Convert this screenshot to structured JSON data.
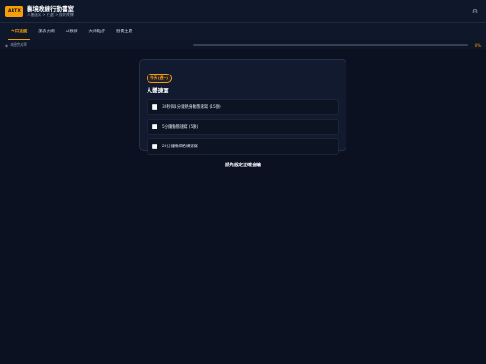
{
  "header": {
    "logo_text": "ARTX",
    "title": "藝境教練行動書室",
    "breadcrumb": "人體速寫 > 任選 > 我的教練",
    "settings_icon": "gear-icon"
  },
  "tabs": [
    {
      "label": "今日進度",
      "active": true
    },
    {
      "label": "課表大綱",
      "active": false
    },
    {
      "label": "AI教練",
      "active": false
    },
    {
      "label": "大師點評",
      "active": false
    },
    {
      "label": "習慣主題",
      "active": false
    }
  ],
  "progress": {
    "label": "本週完成率",
    "percent_value": 0,
    "percent_text": "0%"
  },
  "task": {
    "badge": "今天 (週一)",
    "title": "人體速寫",
    "options": [
      {
        "label": "30秒與1分鐘熱身動態速寫 (15張)",
        "checked": false
      },
      {
        "label": "5分鐘動態速寫 (5張)",
        "checked": false
      },
      {
        "label": "20分鐘精細結構速寫",
        "checked": false
      }
    ]
  },
  "prompt": "請先設定正確金鑰",
  "colors": {
    "accent": "#f59e0b",
    "background": "#0b1120",
    "card": "#111a2e"
  }
}
